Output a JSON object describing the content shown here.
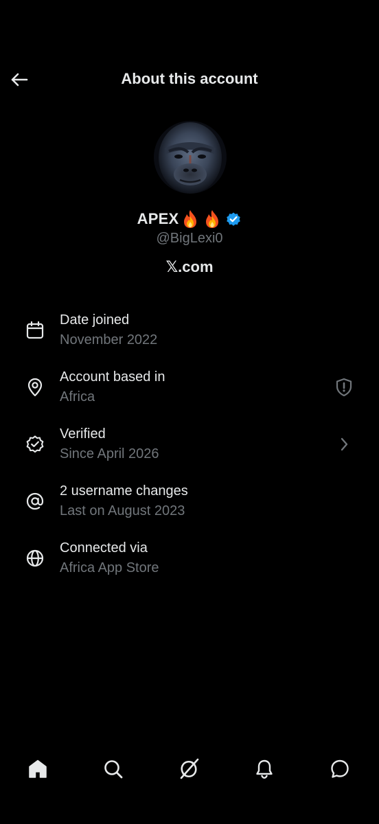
{
  "header": {
    "title": "About this account",
    "back_icon": "arrow-left-icon"
  },
  "profile": {
    "display_name": "APEX",
    "emojis": [
      "🔥",
      "🔥"
    ],
    "verified_color": "#1d9bf0",
    "handle": "@BigLexi0",
    "site": "𝕏.com"
  },
  "info_rows": [
    {
      "icon": "calendar-icon",
      "title": "Date joined",
      "subtitle": "November 2022",
      "trailing": ""
    },
    {
      "icon": "location-pin-icon",
      "title": "Account based in",
      "subtitle": "Africa",
      "trailing": "shield-icon"
    },
    {
      "icon": "verified-badge-icon",
      "title": "Verified",
      "subtitle": "Since April 2026",
      "trailing": "chevron-right-icon"
    },
    {
      "icon": "at-sign-icon",
      "title": "2 username changes",
      "subtitle": "Last on August 2023",
      "trailing": ""
    },
    {
      "icon": "globe-icon",
      "title": "Connected via",
      "subtitle": "Africa App Store",
      "trailing": ""
    }
  ],
  "bottom_nav": [
    "home-icon",
    "search-icon",
    "grok-icon",
    "bell-icon",
    "messages-icon"
  ],
  "colors": {
    "background": "#000000",
    "primary_text": "#e7e9ea",
    "secondary_text": "#71767b",
    "accent": "#1d9bf0"
  }
}
